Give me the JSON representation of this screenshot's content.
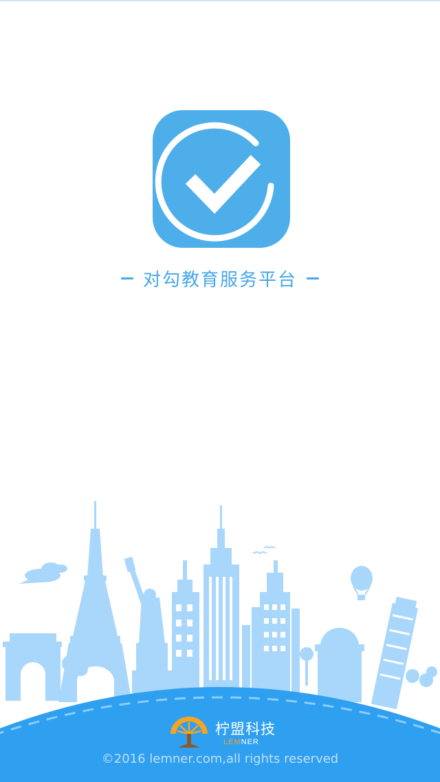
{
  "splash": {
    "app_icon": "checkmark-circle-icon",
    "tagline": "对勾教育服务平台",
    "illustration": "city-skyline-landmarks",
    "company": {
      "logo": "lemner-tree-logo-icon",
      "name_cn": "柠盟科技",
      "name_en_part1": "LEM",
      "name_en_part2": "NER"
    },
    "copyright": "©2016 lemner.com,all rights reserved"
  },
  "colors": {
    "primary": "#47a7e8",
    "icon_bg": "#4daeea",
    "ground": "#2f9ff0",
    "skyline": "#a9d7fb",
    "brand_accent": "#f4a623"
  }
}
